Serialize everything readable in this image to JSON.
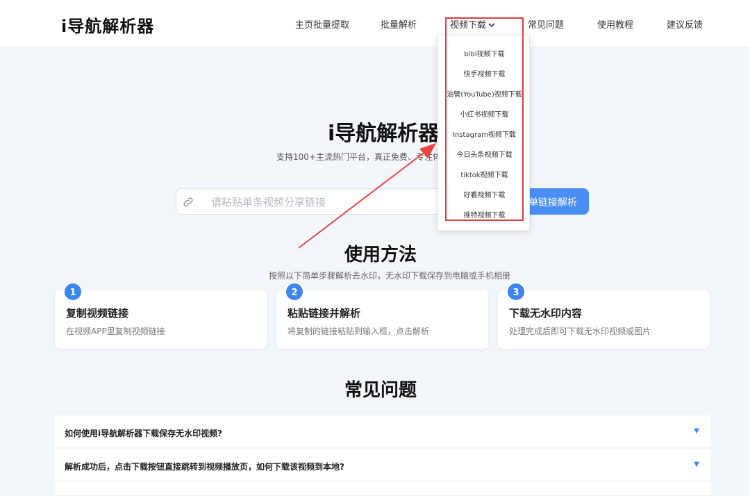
{
  "header": {
    "logo": "i导航解析器",
    "nav": [
      {
        "label": "主页批量提取"
      },
      {
        "label": "批量解析"
      },
      {
        "label": "视频下载"
      },
      {
        "label": "常见问题"
      },
      {
        "label": "使用教程"
      },
      {
        "label": "建议反馈"
      }
    ]
  },
  "dropdown": {
    "items": [
      "blbl视频下载",
      "快手视频下载",
      "油管(YouTube)视频下载",
      "小红书视频下载",
      "Instagram视频下载",
      "今日头条视频下载",
      "tiktok视频下载",
      "好看视频下载",
      "推特视频下载"
    ]
  },
  "hero": {
    "title": "i导航解析器",
    "subtitle": "支持100+主流热门平台，真正免费、专注体"
  },
  "search": {
    "placeholder": "请粘贴单条视频分享链接",
    "button": "单链接解析"
  },
  "usage": {
    "title": "使用方法",
    "subtitle": "按照以下简单步骤解析去水印，无水印下载保存到电脑或手机相册",
    "steps": [
      {
        "num": "1",
        "title": "复制视频链接",
        "desc": "在视频APP里复制视频链接"
      },
      {
        "num": "2",
        "title": "粘贴链接并解析",
        "desc": "将复制的链接粘贴到输入框，点击解析"
      },
      {
        "num": "3",
        "title": "下载无水印内容",
        "desc": "处理完成后即可下载无水印视频或图片"
      }
    ]
  },
  "faq": {
    "title": "常见问题",
    "items": [
      {
        "q": "如何使用i导航解析器下载保存无水印视频?"
      },
      {
        "q": "解析成功后，点击下载按钮直接跳转到视频播放页，如何下载该视频到本地?"
      }
    ]
  },
  "colors": {
    "accent": "#4a8ef5",
    "highlight": "#e23b3b"
  }
}
